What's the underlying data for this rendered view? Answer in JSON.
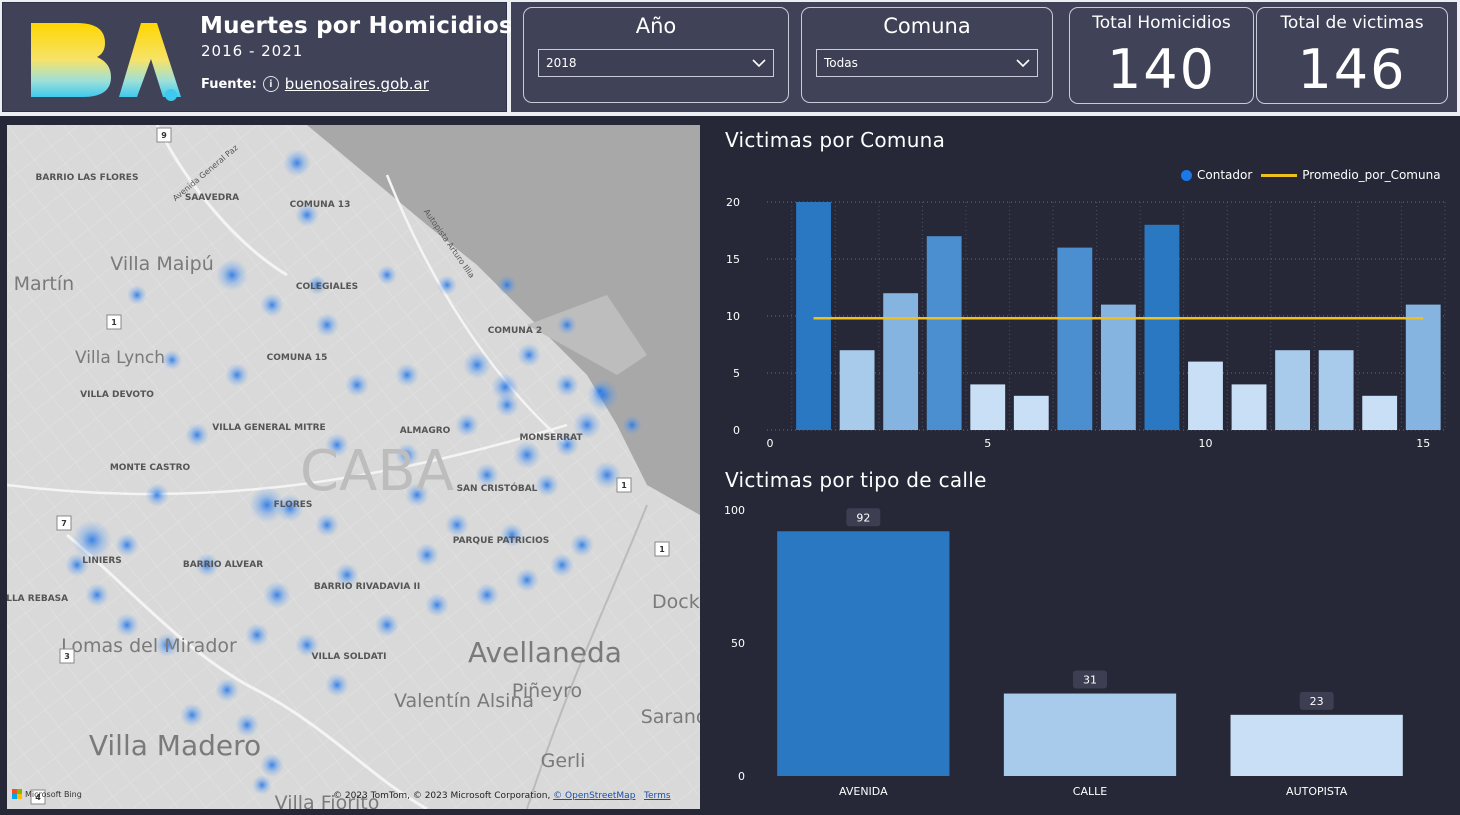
{
  "header": {
    "title": "Muertes por Homicidios",
    "years": "2016 - 2021",
    "source_label": "Fuente:",
    "source_link": "buenosaires.gob.ar",
    "logo_text": "BA"
  },
  "filters": {
    "year": {
      "title": "Año",
      "selected": "2018"
    },
    "commune": {
      "title": "Comuna",
      "selected": "Todas"
    }
  },
  "kpis": {
    "homicides": {
      "title": "Total Homicidios",
      "value": "140"
    },
    "victims": {
      "title": "Total de victimas",
      "value": "146"
    }
  },
  "map": {
    "labels": [
      "BARRIO LAS FLORES",
      "SAAVEDRA",
      "COMUNA 13",
      "Villa Maipú",
      "San Martín",
      "COLEGIALES",
      "COMUNA 2",
      "Villa Lynch",
      "COMUNA 15",
      "VILLA DEVOTO",
      "VILLA GENERAL MITRE",
      "ALMAGRO",
      "MONSERRAT",
      "MONTE CASTRO",
      "CABA",
      "SAN CRISTÓBAL",
      "FLORES",
      "LINIERS",
      "BARRIO ALVEAR",
      "PARQUE PATRICIOS",
      "BARRIO RIVADAVIA II",
      "VILLA REBASA",
      "Lomas del Mirador",
      "VILLA SOLDATI",
      "Avellaneda",
      "Piñeyro",
      "Valentín Alsina",
      "Sarandí",
      "Villa Madero",
      "Gerli",
      "Villa Fiorito",
      "Autopista Arturo Illia",
      "Avenida General Paz",
      "Dock Sud"
    ],
    "route_shields": [
      "9",
      "1",
      "7",
      "3",
      "1",
      "1",
      "4"
    ],
    "attribution": "© 2023 TomTom, © 2023 Microsoft Corporation, ",
    "attribution_link": "© OpenStreetMap",
    "terms_link": "Terms",
    "bing_label": "Microsoft Bing"
  },
  "colors": {
    "dark_bar": "#2b78c2",
    "mid_bar": "#4b8fd0",
    "light_bar": "#86b4e0",
    "pale_bar": "#a8cbeb",
    "palest_bar": "#c8dff5",
    "avg_line": "#f0c020",
    "heat": "#2a7ee8"
  },
  "chart_data": [
    {
      "type": "bar",
      "title": "Victimas por Comuna",
      "x": [
        1,
        2,
        3,
        4,
        5,
        6,
        7,
        8,
        9,
        10,
        11,
        12,
        13,
        14,
        15
      ],
      "series": [
        {
          "name": "Contador",
          "values": [
            20,
            7,
            12,
            17,
            4,
            3,
            16,
            11,
            18,
            6,
            4,
            7,
            7,
            3,
            11
          ]
        },
        {
          "name": "Promedio_por_Comuna",
          "type": "line",
          "values": [
            9.8,
            9.8,
            9.8,
            9.8,
            9.8,
            9.8,
            9.8,
            9.8,
            9.8,
            9.8,
            9.8,
            9.8,
            9.8,
            9.8,
            9.8
          ]
        }
      ],
      "xticks": [
        0,
        5,
        10,
        15
      ],
      "xlim": [
        0,
        15.5
      ],
      "yticks": [
        0,
        5,
        10,
        15,
        20
      ],
      "ylim": [
        0,
        20
      ],
      "grid": true,
      "legend": "top-right",
      "xlabel": "",
      "ylabel": ""
    },
    {
      "type": "bar",
      "title": "Victimas por tipo de calle",
      "categories": [
        "AVENIDA",
        "CALLE",
        "AUTOPISTA"
      ],
      "values": [
        92,
        31,
        23
      ],
      "yticks": [
        0,
        50,
        100
      ],
      "ylim": [
        0,
        100
      ],
      "data_labels": true,
      "xlabel": "",
      "ylabel": ""
    }
  ]
}
